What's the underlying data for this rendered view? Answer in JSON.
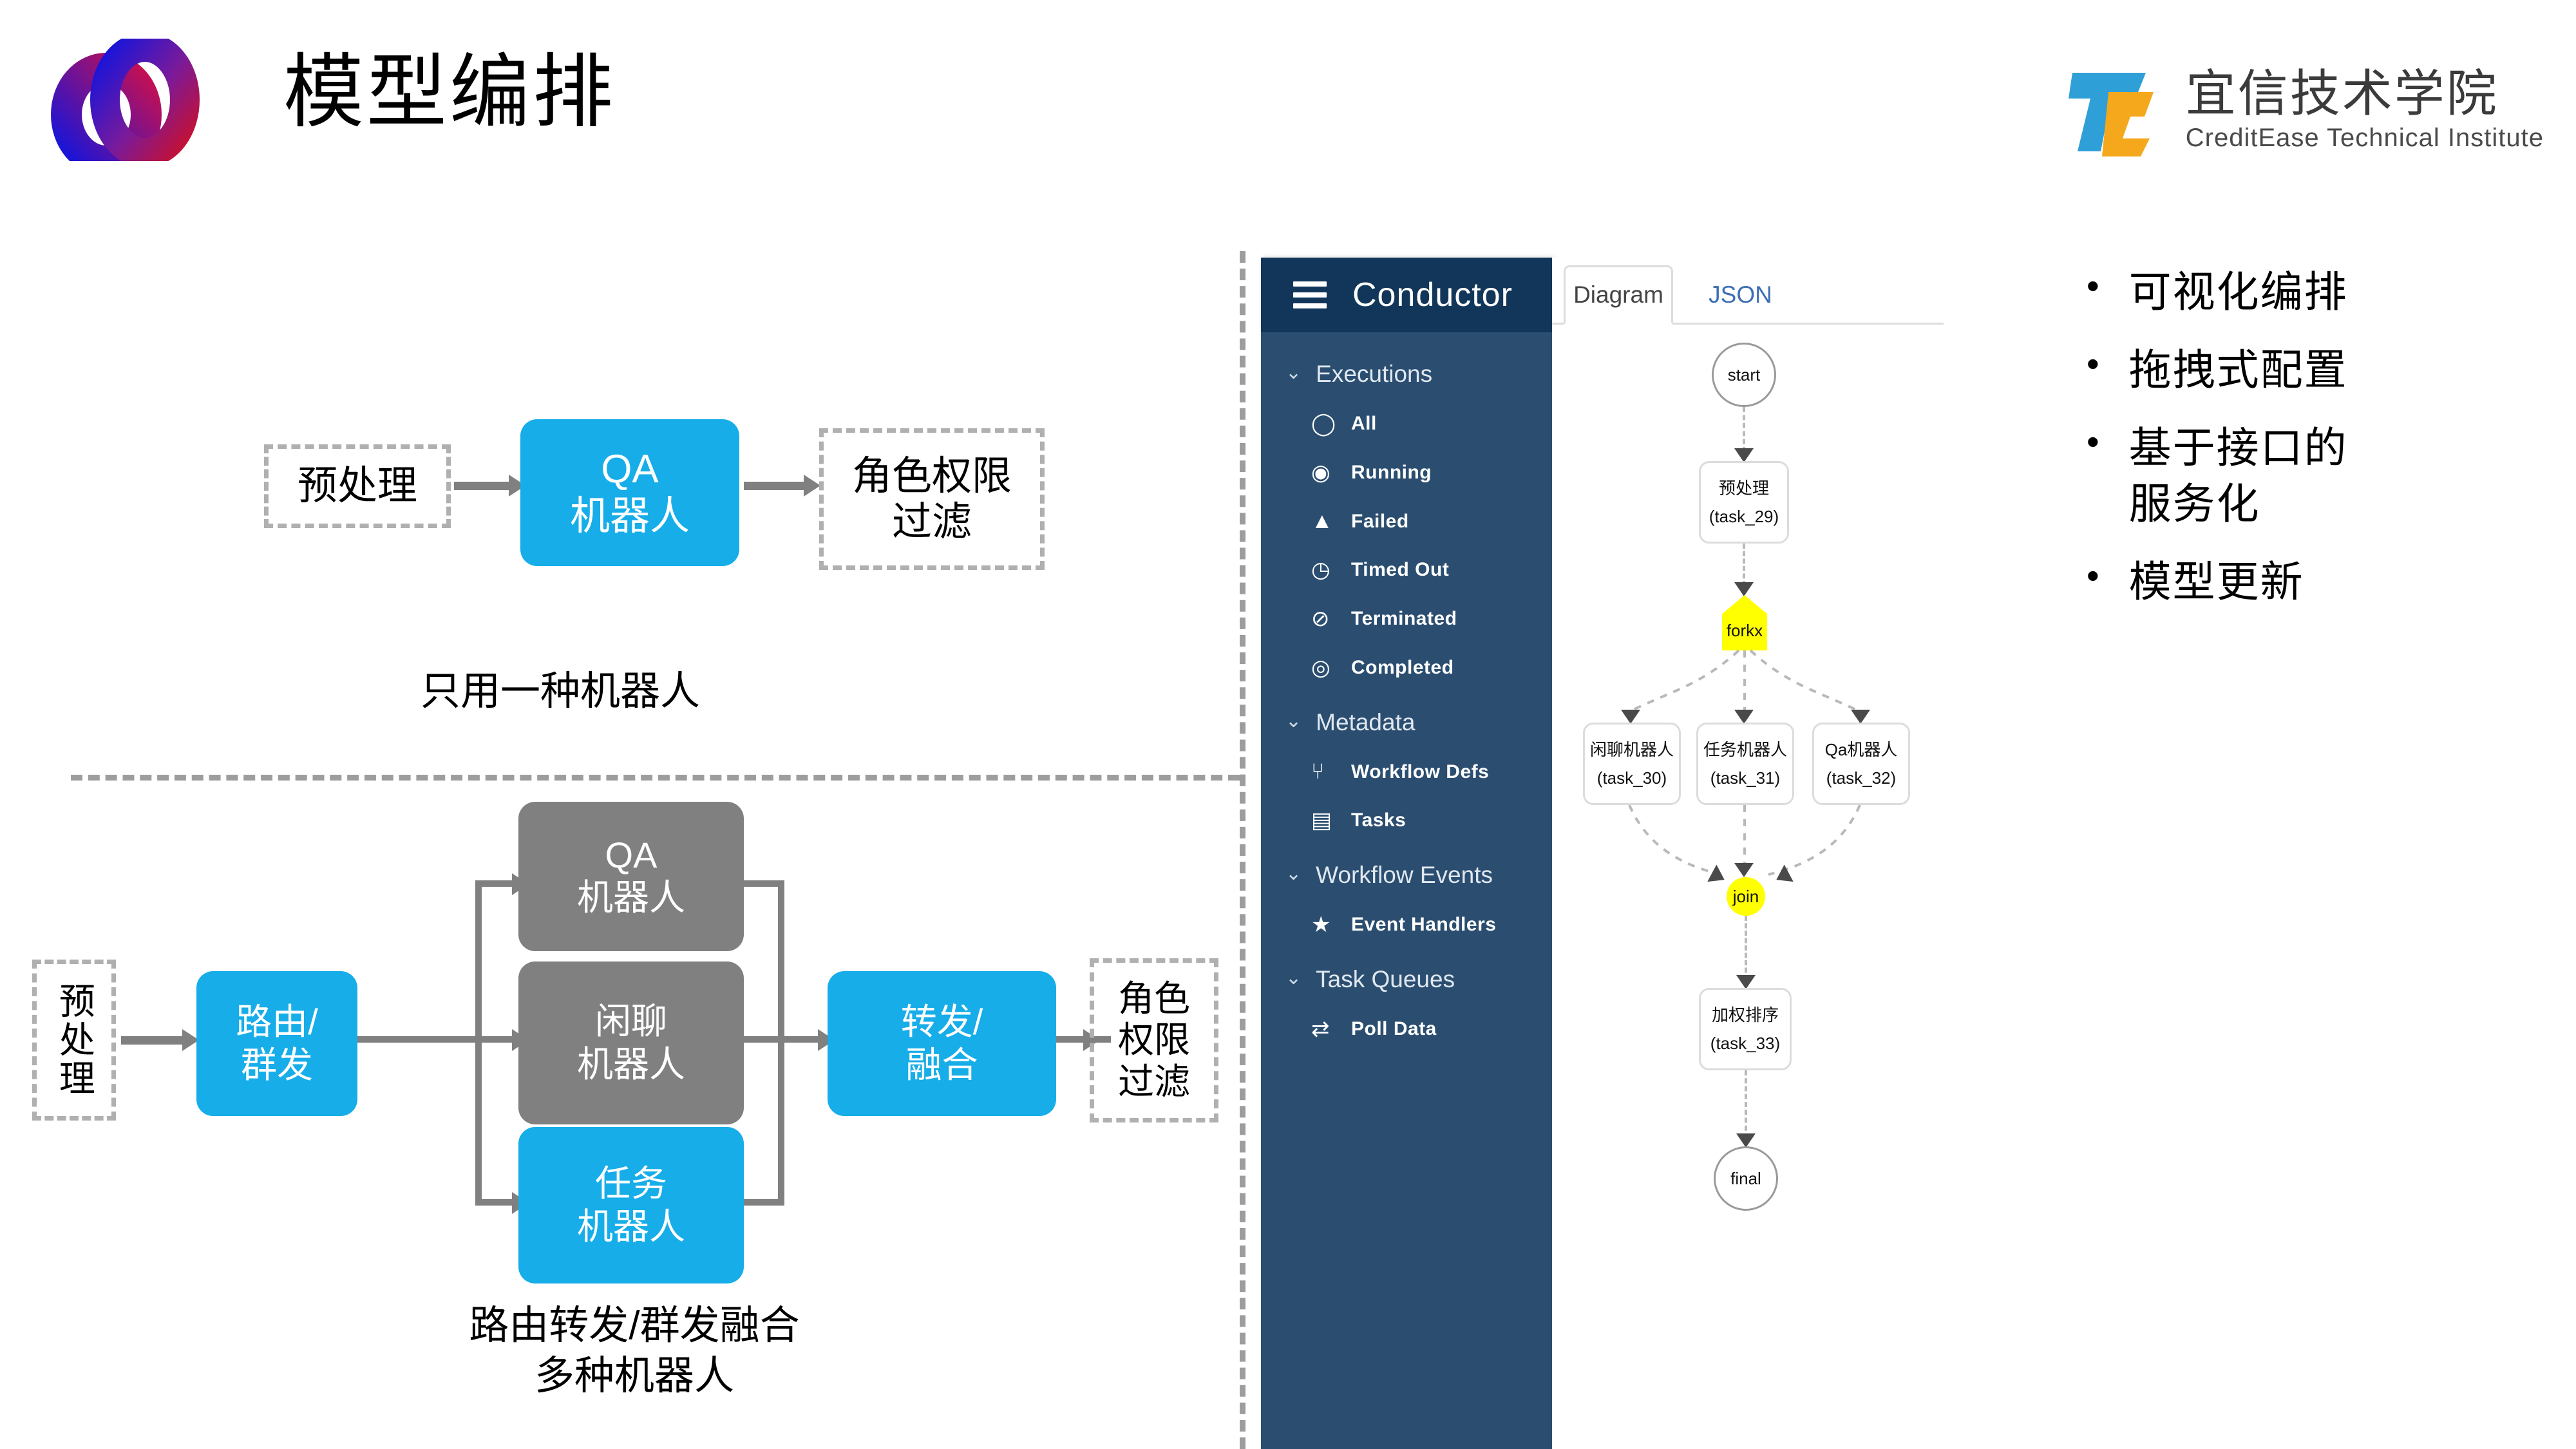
{
  "header": {
    "title": "模型编排",
    "logo_icon": "overlapping-rings-logo",
    "brand_cn": "宜信技术学院",
    "brand_en": "CreditEase Technical Institute",
    "brand_mark_icon": "tc-monogram-logo",
    "colors": {
      "ring_blue": "#1414dc",
      "ring_red": "#c8102e",
      "brand_blue": "#2f9fd8",
      "brand_orange": "#f5a81c"
    }
  },
  "left_panel": {
    "top_flow": {
      "nodes": [
        {
          "id": "pre",
          "label": "预处理",
          "style": "dashed"
        },
        {
          "id": "qa",
          "label": "QA\n机器人",
          "style": "blue"
        },
        {
          "id": "filter",
          "label": "角色权限\n过滤",
          "style": "dashed"
        }
      ],
      "caption": "只用一种机器人"
    },
    "bottom_flow": {
      "nodes": [
        {
          "id": "pre2",
          "label": "预处理",
          "style": "dashed-vertical"
        },
        {
          "id": "route",
          "label": "路由/\n群发",
          "style": "blue"
        },
        {
          "id": "qa2",
          "label": "QA\n机器人",
          "style": "gray"
        },
        {
          "id": "chat",
          "label": "闲聊\n机器人",
          "style": "gray"
        },
        {
          "id": "task",
          "label": "任务\n机器人",
          "style": "blue"
        },
        {
          "id": "merge",
          "label": "转发/\n融合",
          "style": "blue"
        },
        {
          "id": "filter2",
          "label": "角色\n权限\n过滤",
          "style": "dashed"
        }
      ],
      "caption": "路由转发/群发融合\n多种机器人"
    },
    "colors": {
      "blue": "#16ADE9",
      "gray": "#808080",
      "dashed_border": "#b0b0b0",
      "arrow": "#808080"
    }
  },
  "conductor": {
    "sidebar": {
      "title": "Conductor",
      "menu_icon": "hamburger-icon",
      "groups": [
        {
          "label": "Executions",
          "chevron": "chevron-down-icon",
          "items": [
            {
              "label": "All",
              "icon": "circle-outline-icon",
              "glyph": "◯"
            },
            {
              "label": "Running",
              "icon": "play-circle-icon",
              "glyph": "◉"
            },
            {
              "label": "Failed",
              "icon": "warning-triangle-icon",
              "glyph": "▲"
            },
            {
              "label": "Timed Out",
              "icon": "clock-icon",
              "glyph": "◷"
            },
            {
              "label": "Terminated",
              "icon": "no-entry-icon",
              "glyph": "⊘"
            },
            {
              "label": "Completed",
              "icon": "target-circle-icon",
              "glyph": "◎"
            }
          ]
        },
        {
          "label": "Metadata",
          "chevron": "chevron-down-icon",
          "items": [
            {
              "label": "Workflow Defs",
              "icon": "branch-icon",
              "glyph": "⑂"
            },
            {
              "label": "Tasks",
              "icon": "list-icon",
              "glyph": "▤"
            }
          ]
        },
        {
          "label": "Workflow Events",
          "chevron": "chevron-down-icon",
          "items": [
            {
              "label": "Event Handlers",
              "icon": "star-icon",
              "glyph": "★"
            }
          ]
        },
        {
          "label": "Task Queues",
          "chevron": "chevron-down-icon",
          "items": [
            {
              "label": "Poll Data",
              "icon": "transfer-arrows-icon",
              "glyph": "⇄"
            }
          ]
        }
      ]
    },
    "tabs": [
      {
        "label": "Diagram",
        "active": true
      },
      {
        "label": "JSON",
        "active": false
      }
    ],
    "graph": {
      "nodes": [
        {
          "id": "start",
          "type": "circle",
          "label": "start",
          "sub": ""
        },
        {
          "id": "task_29",
          "type": "task",
          "label": "预处理",
          "sub": "(task_29)"
        },
        {
          "id": "forkx",
          "type": "fork",
          "label": "forkx",
          "sub": ""
        },
        {
          "id": "task_30",
          "type": "task",
          "label": "闲聊机器人",
          "sub": "(task_30)"
        },
        {
          "id": "task_31",
          "type": "task",
          "label": "任务机器人",
          "sub": "(task_31)"
        },
        {
          "id": "task_32",
          "type": "task",
          "label": "Qa机器人",
          "sub": "(task_32)"
        },
        {
          "id": "join",
          "type": "join",
          "label": "join",
          "sub": ""
        },
        {
          "id": "task_33",
          "type": "task",
          "label": "加权排序",
          "sub": "(task_33)"
        },
        {
          "id": "final",
          "type": "circle",
          "label": "final",
          "sub": ""
        }
      ],
      "colors": {
        "fork_join": "#FFFF00",
        "edge": "#b9b9b9",
        "node_border": "#dcdcdc"
      }
    },
    "colors": {
      "sidebar_bg": "#2b4e70",
      "sidebar_header_bg": "#123659",
      "tab_active": "#444444",
      "tab_link": "#3d6fb5"
    }
  },
  "bullets": [
    "可视化编排",
    "拖拽式配置",
    "基于接口的\n服务化",
    "模型更新"
  ]
}
